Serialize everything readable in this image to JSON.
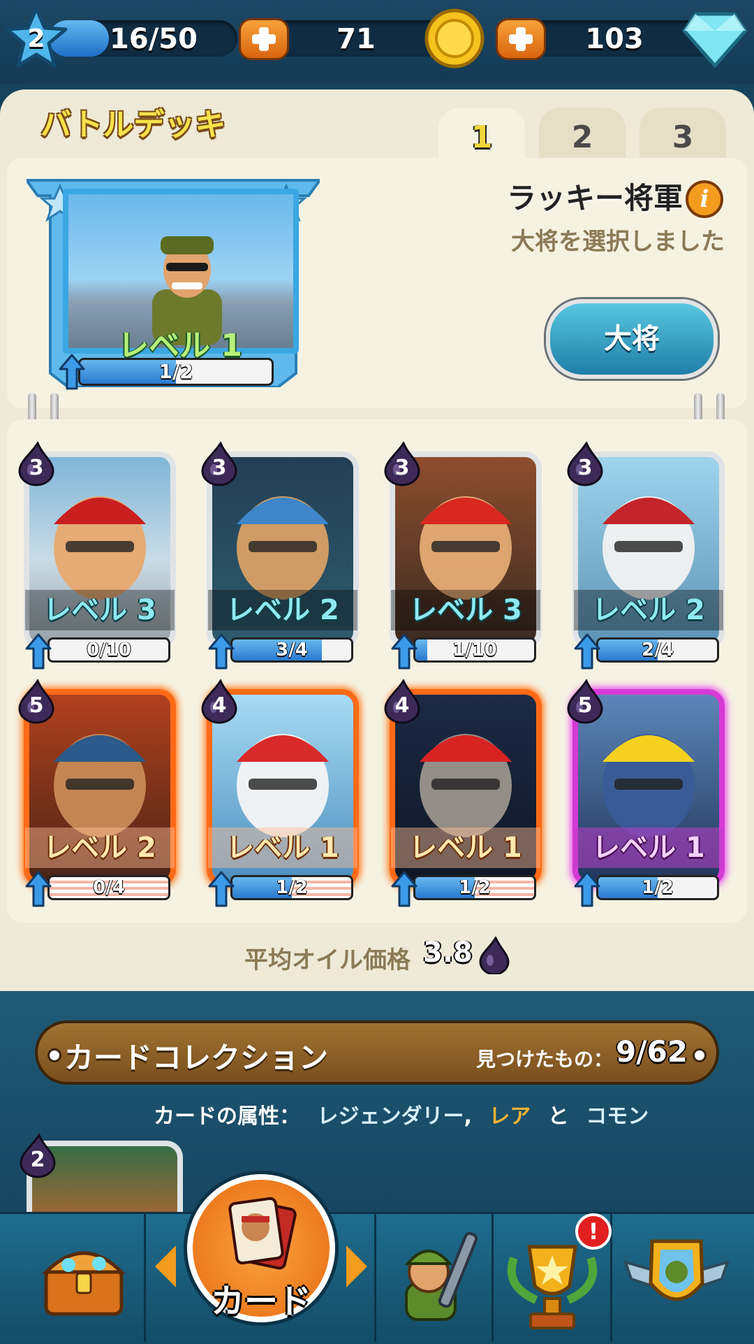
{
  "resources": {
    "player_level": "2",
    "xp": "16/50",
    "xp_progress": 0.32,
    "coins": "71",
    "gems": "103"
  },
  "deck": {
    "title": "バトルデッキ",
    "tabs": [
      "1",
      "2",
      "3"
    ],
    "active_tab": "1"
  },
  "general": {
    "name": "ラッキー将軍",
    "status": "大将を選択しました",
    "level": "レベル 1",
    "progress": "1/2",
    "progress_value": 0.5,
    "button": "大将"
  },
  "cards": [
    {
      "cost": "3",
      "level": "レベル 3",
      "progress": "0/10",
      "progress_value": 0.0,
      "rarity": "common"
    },
    {
      "cost": "3",
      "level": "レベル 2",
      "progress": "3/4",
      "progress_value": 0.75,
      "rarity": "common"
    },
    {
      "cost": "3",
      "level": "レベル 3",
      "progress": "1/10",
      "progress_value": 0.1,
      "rarity": "common"
    },
    {
      "cost": "3",
      "level": "レベル 2",
      "progress": "2/4",
      "progress_value": 0.5,
      "rarity": "common"
    },
    {
      "cost": "5",
      "level": "レベル 2",
      "progress": "0/4",
      "progress_value": 0.0,
      "rarity": "rare"
    },
    {
      "cost": "4",
      "level": "レベル 1",
      "progress": "1/2",
      "progress_value": 0.5,
      "rarity": "rare"
    },
    {
      "cost": "4",
      "level": "レベル 1",
      "progress": "1/2",
      "progress_value": 0.5,
      "rarity": "rare"
    },
    {
      "cost": "5",
      "level": "レベル 1",
      "progress": "1/2",
      "progress_value": 0.5,
      "rarity": "legendary"
    }
  ],
  "average_oil": {
    "label": "平均オイル価格",
    "value": "3.8"
  },
  "collection": {
    "title": "カードコレクション",
    "found_label": "見つけたもの：",
    "found_count": "9/62",
    "attributes_label": "カードの属性：",
    "attr_legendary": "レジェンダリー",
    "attr_separator": ",",
    "attr_rare": "レア",
    "attr_and": "と",
    "attr_common": "コモン",
    "peek_card_cost": "2"
  },
  "nav": {
    "active_label": "カード",
    "items": [
      "chest-icon",
      "card-icon",
      "soldier-icon",
      "trophy-icon",
      "badge-icon"
    ],
    "trophy_alert": "!"
  },
  "colors": {
    "accent_orange": "#f39c1e",
    "rare_glow": "#ff6a17",
    "legendary_glow": "#d53ad6",
    "gold_title": "#f7e34a"
  }
}
